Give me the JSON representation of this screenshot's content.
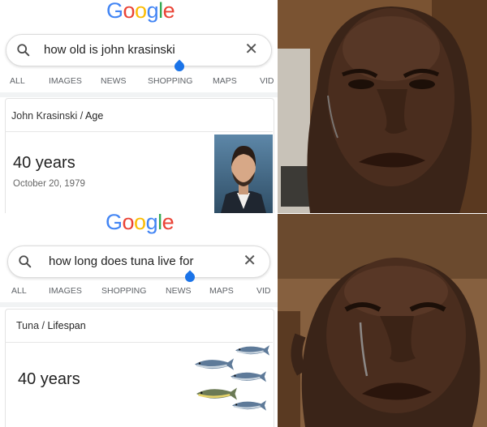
{
  "top": {
    "logo": [
      "G",
      "o",
      "o",
      "g",
      "l",
      "e"
    ],
    "query": "how old is john krasinski",
    "tabs": [
      "ALL",
      "IMAGES",
      "NEWS",
      "SHOPPING",
      "MAPS",
      "VID"
    ],
    "crumb_subject": "John Krasinski",
    "crumb_attr": "Age",
    "answer": "40 years",
    "answer_sub": "October 20, 1979"
  },
  "bottom": {
    "logo": [
      "G",
      "o",
      "o",
      "g",
      "l",
      "e"
    ],
    "query": "how long does tuna live for",
    "tabs": [
      "ALL",
      "IMAGES",
      "SHOPPING",
      "NEWS",
      "MAPS",
      "VID"
    ],
    "crumb_subject": "Tuna",
    "crumb_attr": "Lifespan",
    "answer": "40 years"
  },
  "colors": {
    "blue": "#4285F4",
    "red": "#EA4335",
    "yellow": "#FBBC05",
    "green": "#34A853",
    "drop": "#1a73e8"
  },
  "icons": [
    "search-icon",
    "close-icon",
    "cursor-drop-icon",
    "tuna-fish-icon"
  ]
}
